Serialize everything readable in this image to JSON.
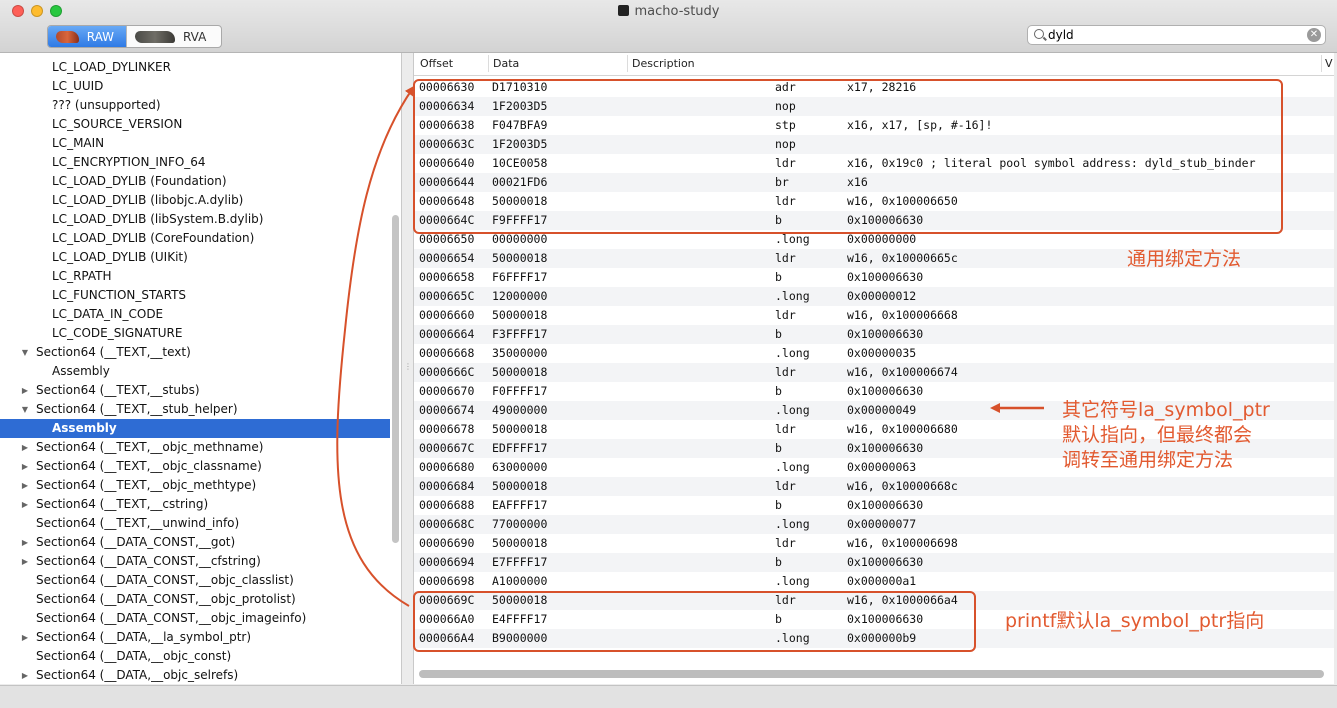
{
  "window": {
    "title": "macho-study"
  },
  "toolbar": {
    "mode_options": [
      "RAW",
      "RVA"
    ],
    "selected_mode": "RAW",
    "search": {
      "value": "dyld"
    }
  },
  "sidebar": {
    "items": [
      {
        "label": "LC_LOAD_DYLINKER",
        "indent": 2,
        "disclosure": "",
        "selected": false
      },
      {
        "label": "LC_UUID",
        "indent": 2,
        "disclosure": "",
        "selected": false
      },
      {
        "label": "??? (unsupported)",
        "indent": 2,
        "disclosure": "",
        "selected": false
      },
      {
        "label": "LC_SOURCE_VERSION",
        "indent": 2,
        "disclosure": "",
        "selected": false
      },
      {
        "label": "LC_MAIN",
        "indent": 2,
        "disclosure": "",
        "selected": false
      },
      {
        "label": "LC_ENCRYPTION_INFO_64",
        "indent": 2,
        "disclosure": "",
        "selected": false
      },
      {
        "label": "LC_LOAD_DYLIB (Foundation)",
        "indent": 2,
        "disclosure": "",
        "selected": false
      },
      {
        "label": "LC_LOAD_DYLIB (libobjc.A.dylib)",
        "indent": 2,
        "disclosure": "",
        "selected": false
      },
      {
        "label": "LC_LOAD_DYLIB (libSystem.B.dylib)",
        "indent": 2,
        "disclosure": "",
        "selected": false
      },
      {
        "label": "LC_LOAD_DYLIB (CoreFoundation)",
        "indent": 2,
        "disclosure": "",
        "selected": false
      },
      {
        "label": "LC_LOAD_DYLIB (UIKit)",
        "indent": 2,
        "disclosure": "",
        "selected": false
      },
      {
        "label": "LC_RPATH",
        "indent": 2,
        "disclosure": "",
        "selected": false
      },
      {
        "label": "LC_FUNCTION_STARTS",
        "indent": 2,
        "disclosure": "",
        "selected": false
      },
      {
        "label": "LC_DATA_IN_CODE",
        "indent": 2,
        "disclosure": "",
        "selected": false
      },
      {
        "label": "LC_CODE_SIGNATURE",
        "indent": 2,
        "disclosure": "",
        "selected": false
      },
      {
        "label": "Section64 (__TEXT,__text)",
        "indent": 1,
        "disclosure": "open",
        "selected": false
      },
      {
        "label": "Assembly",
        "indent": 2,
        "disclosure": "",
        "selected": false
      },
      {
        "label": "Section64 (__TEXT,__stubs)",
        "indent": 1,
        "disclosure": "closed",
        "selected": false
      },
      {
        "label": "Section64 (__TEXT,__stub_helper)",
        "indent": 1,
        "disclosure": "open",
        "selected": false
      },
      {
        "label": "Assembly",
        "indent": 2,
        "disclosure": "",
        "selected": true
      },
      {
        "label": "Section64 (__TEXT,__objc_methname)",
        "indent": 1,
        "disclosure": "closed",
        "selected": false
      },
      {
        "label": "Section64 (__TEXT,__objc_classname)",
        "indent": 1,
        "disclosure": "closed",
        "selected": false
      },
      {
        "label": "Section64 (__TEXT,__objc_methtype)",
        "indent": 1,
        "disclosure": "closed",
        "selected": false
      },
      {
        "label": "Section64 (__TEXT,__cstring)",
        "indent": 1,
        "disclosure": "closed",
        "selected": false
      },
      {
        "label": "Section64 (__TEXT,__unwind_info)",
        "indent": 1,
        "disclosure": "",
        "selected": false
      },
      {
        "label": "Section64 (__DATA_CONST,__got)",
        "indent": 1,
        "disclosure": "closed",
        "selected": false
      },
      {
        "label": "Section64 (__DATA_CONST,__cfstring)",
        "indent": 1,
        "disclosure": "closed",
        "selected": false
      },
      {
        "label": "Section64 (__DATA_CONST,__objc_classlist)",
        "indent": 1,
        "disclosure": "",
        "selected": false
      },
      {
        "label": "Section64 (__DATA_CONST,__objc_protolist)",
        "indent": 1,
        "disclosure": "",
        "selected": false
      },
      {
        "label": "Section64 (__DATA_CONST,__objc_imageinfo)",
        "indent": 1,
        "disclosure": "",
        "selected": false
      },
      {
        "label": "Section64 (__DATA,__la_symbol_ptr)",
        "indent": 1,
        "disclosure": "closed",
        "selected": false
      },
      {
        "label": "Section64 (__DATA,__objc_const)",
        "indent": 1,
        "disclosure": "",
        "selected": false
      },
      {
        "label": "Section64 (__DATA,__objc_selrefs)",
        "indent": 1,
        "disclosure": "closed",
        "selected": false
      }
    ]
  },
  "table": {
    "columns": {
      "offset": "Offset",
      "data": "Data",
      "description": "Description",
      "value": "V"
    },
    "rows": [
      {
        "offset": "00006630",
        "data": "D1710310",
        "mnemonic": "adr",
        "operands": "x17, 28216"
      },
      {
        "offset": "00006634",
        "data": "1F2003D5",
        "mnemonic": "nop",
        "operands": ""
      },
      {
        "offset": "00006638",
        "data": "F047BFA9",
        "mnemonic": "stp",
        "operands": "x16, x17, [sp, #-16]!"
      },
      {
        "offset": "0000663C",
        "data": "1F2003D5",
        "mnemonic": "nop",
        "operands": ""
      },
      {
        "offset": "00006640",
        "data": "10CE0058",
        "mnemonic": "ldr",
        "operands": "x16, 0x19c0 ; literal pool symbol address: dyld_stub_binder"
      },
      {
        "offset": "00006644",
        "data": "00021FD6",
        "mnemonic": "br",
        "operands": "x16"
      },
      {
        "offset": "00006648",
        "data": "50000018",
        "mnemonic": "ldr",
        "operands": "w16, 0x100006650"
      },
      {
        "offset": "0000664C",
        "data": "F9FFFF17",
        "mnemonic": "b",
        "operands": "0x100006630"
      },
      {
        "offset": "00006650",
        "data": "00000000",
        "mnemonic": ".long",
        "operands": "0x00000000"
      },
      {
        "offset": "00006654",
        "data": "50000018",
        "mnemonic": "ldr",
        "operands": "w16, 0x10000665c"
      },
      {
        "offset": "00006658",
        "data": "F6FFFF17",
        "mnemonic": "b",
        "operands": "0x100006630"
      },
      {
        "offset": "0000665C",
        "data": "12000000",
        "mnemonic": ".long",
        "operands": "0x00000012"
      },
      {
        "offset": "00006660",
        "data": "50000018",
        "mnemonic": "ldr",
        "operands": "w16, 0x100006668"
      },
      {
        "offset": "00006664",
        "data": "F3FFFF17",
        "mnemonic": "b",
        "operands": "0x100006630"
      },
      {
        "offset": "00006668",
        "data": "35000000",
        "mnemonic": ".long",
        "operands": "0x00000035"
      },
      {
        "offset": "0000666C",
        "data": "50000018",
        "mnemonic": "ldr",
        "operands": "w16, 0x100006674"
      },
      {
        "offset": "00006670",
        "data": "F0FFFF17",
        "mnemonic": "b",
        "operands": "0x100006630"
      },
      {
        "offset": "00006674",
        "data": "49000000",
        "mnemonic": ".long",
        "operands": "0x00000049"
      },
      {
        "offset": "00006678",
        "data": "50000018",
        "mnemonic": "ldr",
        "operands": "w16, 0x100006680"
      },
      {
        "offset": "0000667C",
        "data": "EDFFFF17",
        "mnemonic": "b",
        "operands": "0x100006630"
      },
      {
        "offset": "00006680",
        "data": "63000000",
        "mnemonic": ".long",
        "operands": "0x00000063"
      },
      {
        "offset": "00006684",
        "data": "50000018",
        "mnemonic": "ldr",
        "operands": "w16, 0x10000668c"
      },
      {
        "offset": "00006688",
        "data": "EAFFFF17",
        "mnemonic": "b",
        "operands": "0x100006630"
      },
      {
        "offset": "0000668C",
        "data": "77000000",
        "mnemonic": ".long",
        "operands": "0x00000077"
      },
      {
        "offset": "00006690",
        "data": "50000018",
        "mnemonic": "ldr",
        "operands": "w16, 0x100006698"
      },
      {
        "offset": "00006694",
        "data": "E7FFFF17",
        "mnemonic": "b",
        "operands": "0x100006630"
      },
      {
        "offset": "00006698",
        "data": "A1000000",
        "mnemonic": ".long",
        "operands": "0x000000a1"
      },
      {
        "offset": "0000669C",
        "data": "50000018",
        "mnemonic": "ldr",
        "operands": "w16, 0x1000066a4"
      },
      {
        "offset": "000066A0",
        "data": "E4FFFF17",
        "mnemonic": "b",
        "operands": "0x100006630"
      },
      {
        "offset": "000066A4",
        "data": "B9000000",
        "mnemonic": ".long",
        "operands": "0x000000b9"
      }
    ]
  },
  "annotations": {
    "top_label": "通用绑定方法",
    "middle_label": [
      "其它符号la_symbol_ptr",
      "默认指向，但最终都会",
      "调转至通用绑定方法"
    ],
    "bottom_label": "printf默认la_symbol_ptr指向",
    "color": "#d7512b"
  },
  "colors": {
    "selection": "#2e6cd4",
    "accent": "#2f7ae5"
  }
}
